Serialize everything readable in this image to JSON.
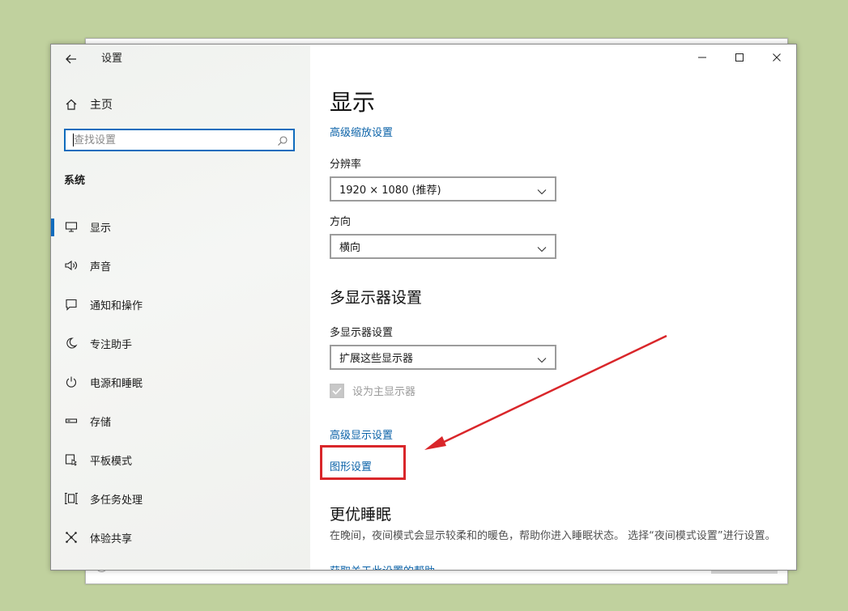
{
  "window": {
    "title": "设置",
    "controls": {
      "minimize": "minimize",
      "maximize": "maximize",
      "close": "close"
    }
  },
  "sidebar": {
    "home_label": "主页",
    "search_placeholder": "查找设置",
    "section_title": "系统",
    "items": [
      {
        "label": "显示",
        "icon": "monitor-icon",
        "active": true
      },
      {
        "label": "声音",
        "icon": "speaker-icon",
        "active": false
      },
      {
        "label": "通知和操作",
        "icon": "notification-icon",
        "active": false
      },
      {
        "label": "专注助手",
        "icon": "moon-icon",
        "active": false
      },
      {
        "label": "电源和睡眠",
        "icon": "power-icon",
        "active": false
      },
      {
        "label": "存储",
        "icon": "storage-icon",
        "active": false
      },
      {
        "label": "平板模式",
        "icon": "tablet-icon",
        "active": false
      },
      {
        "label": "多任务处理",
        "icon": "multitask-icon",
        "active": false
      },
      {
        "label": "体验共享",
        "icon": "share-icon",
        "active": false
      }
    ]
  },
  "main": {
    "title": "显示",
    "advanced_scaling_link": "高级缩放设置",
    "resolution": {
      "label": "分辨率",
      "value": "1920 × 1080 (推荐)"
    },
    "orientation": {
      "label": "方向",
      "value": "横向"
    },
    "multi_display": {
      "title": "多显示器设置",
      "label": "多显示器设置",
      "value": "扩展这些显示器",
      "make_main_label": "设为主显示器",
      "make_main_checked": true
    },
    "advanced_display_link": "高级显示设置",
    "graphics_settings_link": "图形设置",
    "sleep": {
      "title": "更优睡眠",
      "description": "在晚间，夜间模式会显示较柔和的暖色，帮助你进入睡眠状态。 选择“夜间模式设置”进行设置。",
      "clipped_link": "获取关于此设置的帮助"
    }
  },
  "annotation": {
    "color": "#d9262a"
  }
}
